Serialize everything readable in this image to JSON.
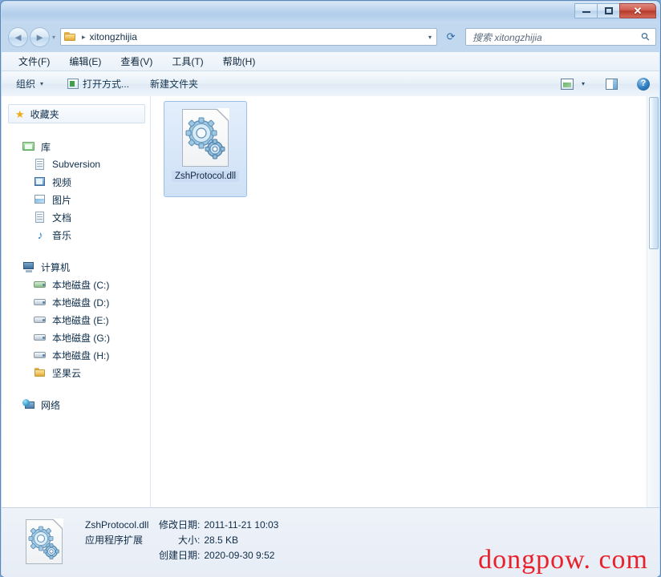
{
  "window": {
    "controls": {
      "minimize": "minimize",
      "maximize": "maximize",
      "close": "✕"
    }
  },
  "address_bar": {
    "back_glyph": "◄",
    "forward_glyph": "►",
    "history_caret": "▾",
    "folder_icon": "folder-icon",
    "crumb_separator": "▸",
    "path": "xitongzhijia",
    "dropdown_caret": "▾",
    "refresh_glyph": "⟳"
  },
  "search": {
    "placeholder": "搜索 xitongzhijia",
    "icon": "search-icon",
    "value": ""
  },
  "menu": {
    "items": [
      {
        "label": "文件(F)"
      },
      {
        "label": "编辑(E)"
      },
      {
        "label": "查看(V)"
      },
      {
        "label": "工具(T)"
      },
      {
        "label": "帮助(H)"
      }
    ]
  },
  "toolbar": {
    "organize_label": "组织",
    "organize_caret": "▾",
    "open_with_label": "打开方式...",
    "new_folder_label": "新建文件夹",
    "view_caret": "▾",
    "help_glyph": "?"
  },
  "sidebar": {
    "favorites": {
      "label": "收藏夹",
      "icon": "star-icon"
    },
    "groups": [
      {
        "header": {
          "label": "库",
          "icon": "library-icon"
        },
        "items": [
          {
            "label": "Subversion",
            "icon": "document-icon"
          },
          {
            "label": "视频",
            "icon": "video-icon"
          },
          {
            "label": "图片",
            "icon": "picture-icon"
          },
          {
            "label": "文档",
            "icon": "document-icon"
          },
          {
            "label": "音乐",
            "icon": "music-icon"
          }
        ]
      },
      {
        "header": {
          "label": "计算机",
          "icon": "computer-icon"
        },
        "items": [
          {
            "label": "本地磁盘 (C:)",
            "icon": "system-drive-icon"
          },
          {
            "label": "本地磁盘 (D:)",
            "icon": "drive-icon"
          },
          {
            "label": "本地磁盘 (E:)",
            "icon": "drive-icon"
          },
          {
            "label": "本地磁盘 (G:)",
            "icon": "drive-icon"
          },
          {
            "label": "本地磁盘 (H:)",
            "icon": "drive-icon"
          },
          {
            "label": "坚果云",
            "icon": "folder-icon"
          }
        ]
      },
      {
        "header": {
          "label": "网络",
          "icon": "network-icon"
        },
        "items": []
      }
    ]
  },
  "content": {
    "files": [
      {
        "name": "ZshProtocol.dll",
        "icon": "dll-gears-icon",
        "selected": true
      }
    ]
  },
  "status": {
    "icon": "dll-gears-icon",
    "file_name": "ZshProtocol.dll",
    "file_type": "应用程序扩展",
    "modified_label": "修改日期:",
    "modified_value": "2011-11-21 10:03",
    "size_label": "大小:",
    "size_value": "28.5 KB",
    "created_label": "创建日期:",
    "created_value": "2020-09-30 9:52"
  },
  "watermark": {
    "text": "dongpow. com",
    "color": "#e8212b"
  },
  "colors": {
    "title_bar": "#b9d2ec",
    "selection": "#cfe1f6",
    "selection_border": "#9cc0e4",
    "content_bg": "#ffffff",
    "status_bg": "#eef2f9"
  }
}
